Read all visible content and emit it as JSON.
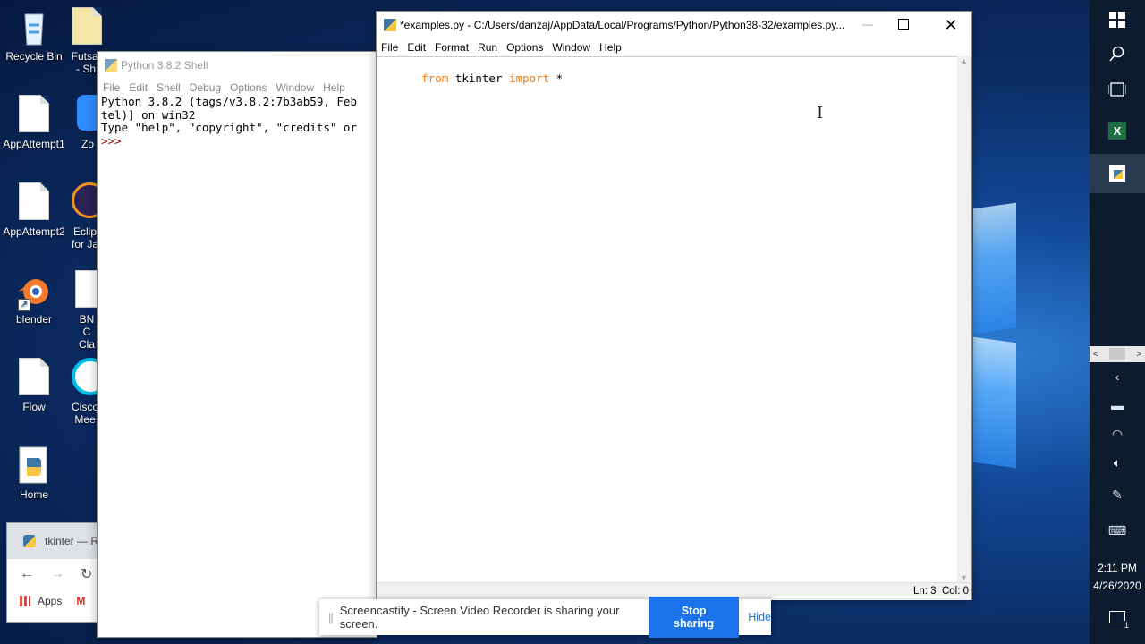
{
  "desktop": {
    "icons": [
      {
        "label": "Recycle Bin",
        "line2": ""
      },
      {
        "label": "AppAttempt1",
        "line2": ""
      },
      {
        "label": "AppAttempt2",
        "line2": ""
      },
      {
        "label": "blender",
        "line2": ""
      },
      {
        "label": "Flow",
        "line2": ""
      },
      {
        "label": "Home",
        "line2": ""
      }
    ],
    "icons_col2": [
      {
        "label": "Futsal",
        "line2": "- Sh"
      },
      {
        "label": "Zo",
        "line2": ""
      },
      {
        "label": "Eclip",
        "line2": "for Ja"
      },
      {
        "label": "BN C",
        "line2": "Cla"
      },
      {
        "label": "Cisco",
        "line2": "Mee"
      }
    ]
  },
  "shell": {
    "title": "Python 3.8.2 Shell",
    "menu": [
      "File",
      "Edit",
      "Shell",
      "Debug",
      "Options",
      "Window",
      "Help"
    ],
    "lines": [
      "Python 3.8.2 (tags/v3.8.2:7b3ab59, Feb",
      "tel)] on win32",
      "Type \"help\", \"copyright\", \"credits\" or",
      ">>> "
    ]
  },
  "editor": {
    "title": "*examples.py - C:/Users/danzaj/AppData/Local/Programs/Python/Python38-32/examples.py...",
    "menu": [
      "File",
      "Edit",
      "Format",
      "Run",
      "Options",
      "Window",
      "Help"
    ],
    "code": {
      "kw1": "from",
      "mid": " tkinter ",
      "kw2": "import",
      "rest": " *"
    },
    "status": "Ln: 3  Col: 0",
    "colors": {
      "keyword": "#ff7700",
      "text": "#000000"
    }
  },
  "browser": {
    "tab_title": "tkinter — R",
    "bookmark_apps": "Apps",
    "bookmark_gmail": "M"
  },
  "screencastify": {
    "message": "Screencastify - Screen Video Recorder is sharing your screen.",
    "stop_label": "Stop sharing",
    "hide_label": "Hide"
  },
  "taskbar": {
    "time": "2:11 PM",
    "date": "4/26/2020",
    "notification_count": "1"
  }
}
